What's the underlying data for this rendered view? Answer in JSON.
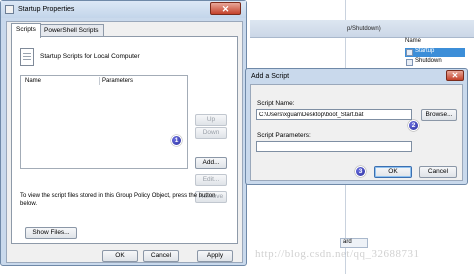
{
  "background": {
    "header_text": "p/Shutdown)",
    "name_column": "Name",
    "items": [
      {
        "label": "Startup",
        "selected": true
      },
      {
        "label": "Shutdown",
        "selected": false
      }
    ],
    "bottom_tab": "ard",
    "watermark": "http://blog.csdn.net/qq_32688731"
  },
  "properties_window": {
    "title": "Startup Properties",
    "close_glyph": "✕",
    "tabs": [
      {
        "label": "Scripts",
        "active": true
      },
      {
        "label": "PowerShell Scripts",
        "active": false
      }
    ],
    "heading": "Startup Scripts for Local Computer",
    "list_columns": [
      "Name",
      "Parameters"
    ],
    "side_buttons": {
      "up": "Up",
      "down": "Down",
      "add": "Add...",
      "edit": "Edit...",
      "remove": "Remove"
    },
    "info_text": "To view the script files stored in this Group Policy Object, press the button below.",
    "show_files": "Show Files...",
    "footer_buttons": {
      "ok": "OK",
      "cancel": "Cancel",
      "apply": "Apply"
    }
  },
  "add_script_dialog": {
    "title": "Add a Script",
    "close_glyph": "✕",
    "script_name_label": "Script Name:",
    "script_name_value": "C:\\Users\\xguan\\Desktop\\boot_Start.bat",
    "browse_label": "Browse...",
    "params_label": "Script Parameters:",
    "params_value": "",
    "ok": "OK",
    "cancel": "Cancel"
  },
  "step_badges": [
    "1",
    "2",
    "3"
  ],
  "colors": {
    "window_frame": "#c9d9ec",
    "close_red": "#c4412a",
    "badge": "#2b2f9c",
    "selection": "#3c8ed8"
  }
}
